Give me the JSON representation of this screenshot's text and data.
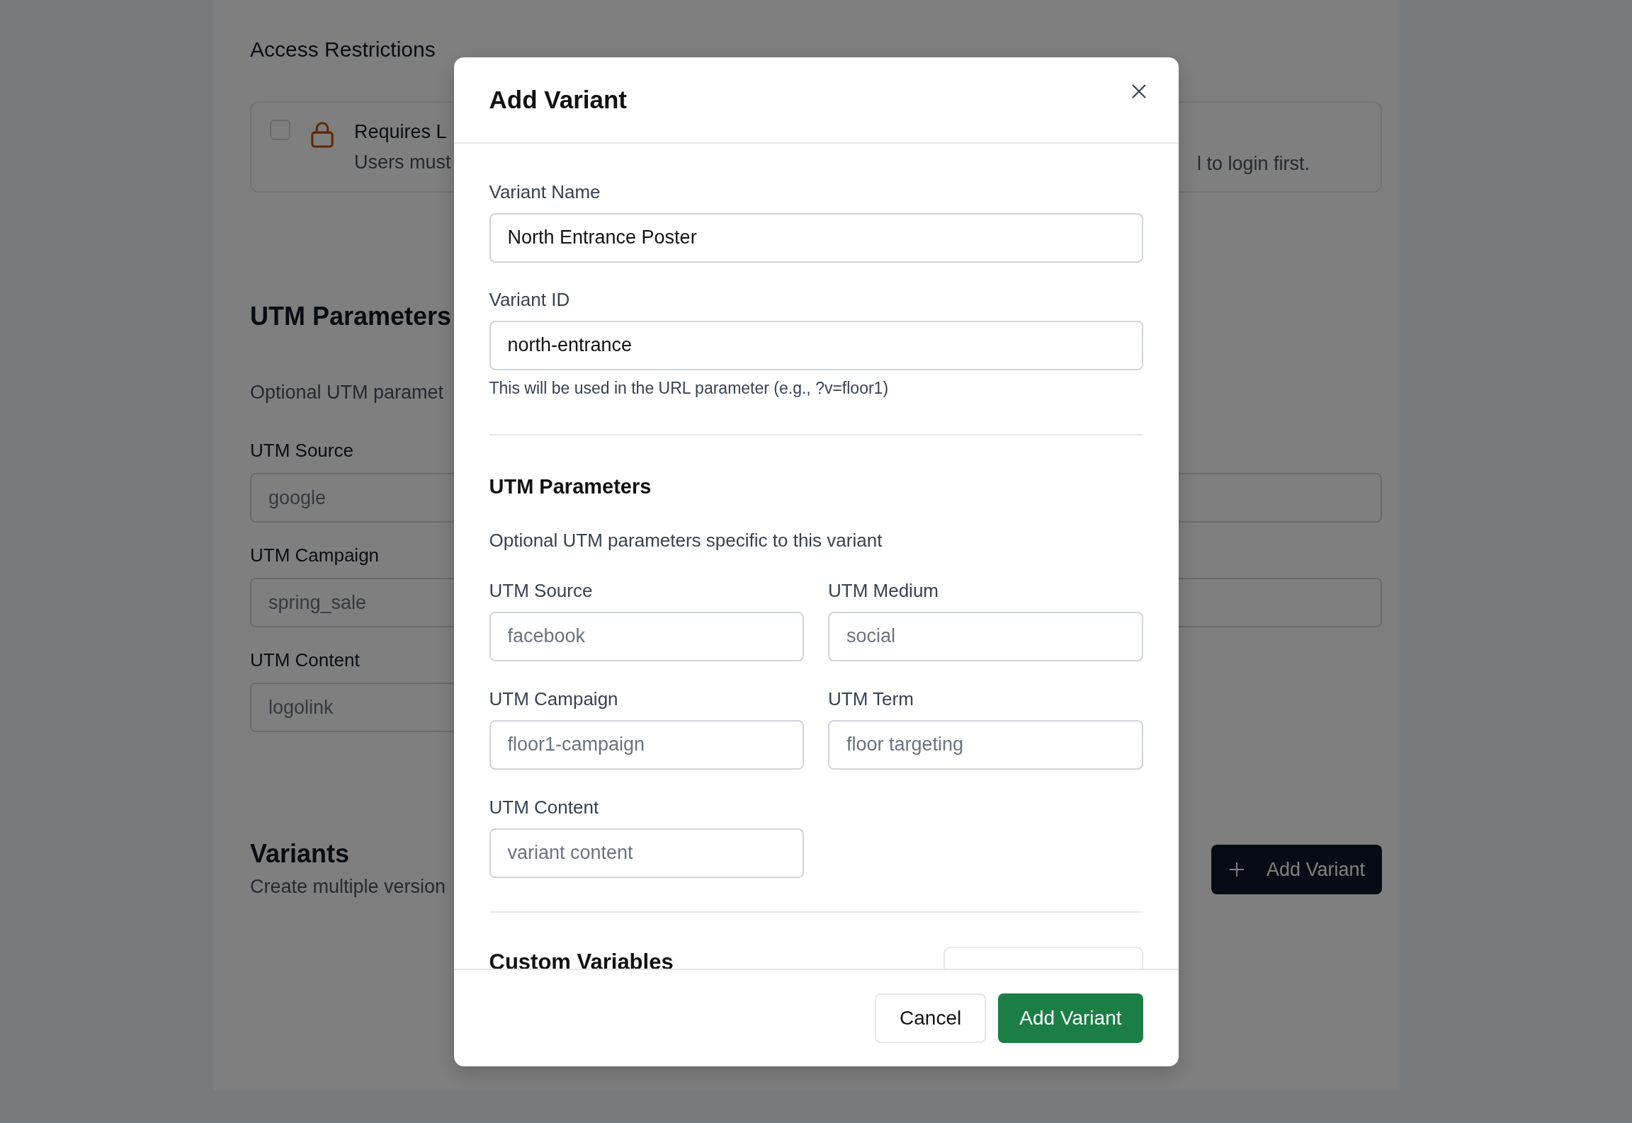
{
  "background": {
    "access": {
      "title": "Access Restrictions",
      "option": {
        "checked": false,
        "title": "Requires L",
        "description": "Users must",
        "description_tail": "l to login first."
      }
    },
    "utm": {
      "title": "UTM Parameters",
      "description": "Optional UTM paramet",
      "rows": [
        {
          "label": "UTM Source",
          "placeholder": "google",
          "paired": true
        },
        {
          "label": "UTM Campaign",
          "placeholder": "spring_sale",
          "paired": true
        },
        {
          "label": "UTM Content",
          "placeholder": "logolink",
          "paired": false
        }
      ]
    },
    "variants": {
      "title": "Variants",
      "description": "Create multiple version",
      "button": "Add Variant"
    }
  },
  "modal": {
    "title": "Add Variant",
    "name_field": {
      "label": "Variant Name",
      "value": "North Entrance Poster"
    },
    "id_field": {
      "label": "Variant ID",
      "value": "north-entrance",
      "help": "This will be used in the URL parameter (e.g., ?v=floor1)"
    },
    "utm": {
      "title": "UTM Parameters",
      "description": "Optional UTM parameters specific to this variant",
      "fields": [
        {
          "label": "UTM Source",
          "placeholder": "facebook"
        },
        {
          "label": "UTM Medium",
          "placeholder": "social"
        },
        {
          "label": "UTM Campaign",
          "placeholder": "floor1-campaign"
        },
        {
          "label": "UTM Term",
          "placeholder": "floor targeting"
        },
        {
          "label": "UTM Content",
          "placeholder": "variant content"
        }
      ]
    },
    "custom": {
      "title": "Custom Variables"
    },
    "buttons": [
      {
        "label": "Cancel",
        "kind": "secondary"
      },
      {
        "label": "Add Variant",
        "kind": "primary"
      }
    ]
  }
}
